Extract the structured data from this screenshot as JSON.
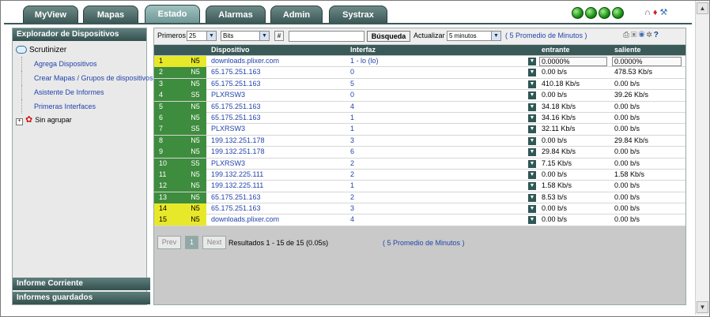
{
  "tabs": [
    {
      "label": "MyView",
      "active": false
    },
    {
      "label": "Mapas",
      "active": false
    },
    {
      "label": "Estado",
      "active": true
    },
    {
      "label": "Alarmas",
      "active": false
    },
    {
      "label": "Admin",
      "active": false
    },
    {
      "label": "Systrax",
      "active": false
    }
  ],
  "sidebar": {
    "title": "Explorador de Dispositivos",
    "root": "Scrutinizer",
    "links": [
      "Agrega Dispositivos",
      "Crear Mapas / Grupos de dispositivos",
      "Asistente De Informes",
      "Primeras Interfaces"
    ],
    "group": "Sin agrupar",
    "footer1": "Informe Corriente",
    "footer2": "Informes guardados"
  },
  "controls": {
    "primeros_label": "Primeros",
    "primeros_value": "25",
    "units_value": "Bits",
    "hash_label": "#",
    "search_value": "",
    "search_button": "Búsqueda",
    "actualizar_label": "Actualizar",
    "actualizar_value": "5 minutos",
    "avg_link": "( 5 Promedio de Minutos )"
  },
  "table": {
    "headers": {
      "device": "Dispositivo",
      "interface": "Interfaz",
      "in": "entrante",
      "out": "saliente"
    },
    "rows": [
      {
        "rank": "1",
        "kind": "N5",
        "device": "downloads.plixer.com",
        "interface": "1 - lo (lo)",
        "in": "0.0000%",
        "out": "0.0000%",
        "color": "yellow",
        "pct": true
      },
      {
        "rank": "2",
        "kind": "N5",
        "device": "65.175.251.163",
        "interface": "0",
        "in": "0.00 b/s",
        "out": "478.53 Kb/s",
        "color": "green"
      },
      {
        "rank": "3",
        "kind": "N5",
        "device": "65.175.251.163",
        "interface": "5",
        "in": "410.18 Kb/s",
        "out": "0.00 b/s",
        "color": "green"
      },
      {
        "rank": "4",
        "kind": "S5",
        "device": "PLXRSW3",
        "interface": "0",
        "in": "0.00 b/s",
        "out": "39.26 Kb/s",
        "color": "green"
      },
      {
        "rank": "5",
        "kind": "N5",
        "device": "65.175.251.163",
        "interface": "4",
        "in": "34.18 Kb/s",
        "out": "0.00 b/s",
        "color": "green"
      },
      {
        "rank": "6",
        "kind": "N5",
        "device": "65.175.251.163",
        "interface": "1",
        "in": "34.16 Kb/s",
        "out": "0.00 b/s",
        "color": "green"
      },
      {
        "rank": "7",
        "kind": "S5",
        "device": "PLXRSW3",
        "interface": "1",
        "in": "32.11 Kb/s",
        "out": "0.00 b/s",
        "color": "green"
      },
      {
        "rank": "8",
        "kind": "N5",
        "device": "199.132.251.178",
        "interface": "3",
        "in": "0.00 b/s",
        "out": "29.84 Kb/s",
        "color": "green"
      },
      {
        "rank": "9",
        "kind": "N5",
        "device": "199.132.251.178",
        "interface": "6",
        "in": "29.84 Kb/s",
        "out": "0.00 b/s",
        "color": "green"
      },
      {
        "rank": "10",
        "kind": "S5",
        "device": "PLXRSW3",
        "interface": "2",
        "in": "7.15 Kb/s",
        "out": "0.00 b/s",
        "color": "green"
      },
      {
        "rank": "11",
        "kind": "N5",
        "device": "199.132.225.111",
        "interface": "2",
        "in": "0.00 b/s",
        "out": "1.58 Kb/s",
        "color": "green"
      },
      {
        "rank": "12",
        "kind": "N5",
        "device": "199.132.225.111",
        "interface": "1",
        "in": "1.58 Kb/s",
        "out": "0.00 b/s",
        "color": "green"
      },
      {
        "rank": "13",
        "kind": "N5",
        "device": "65.175.251.163",
        "interface": "2",
        "in": "8.53 b/s",
        "out": "0.00 b/s",
        "color": "green"
      },
      {
        "rank": "14",
        "kind": "N5",
        "device": "65.175.251.163",
        "interface": "3",
        "in": "0.00 b/s",
        "out": "0.00 b/s",
        "color": "yellow"
      },
      {
        "rank": "15",
        "kind": "N5",
        "device": "downloads.plixer.com",
        "interface": "4",
        "in": "0.00 b/s",
        "out": "0.00 b/s",
        "color": "yellow"
      }
    ]
  },
  "pager": {
    "prev": "Prev",
    "page": "1",
    "next": "Next",
    "results": "Resultados 1 - 15 de 15 (0.05s)",
    "avg_link": "( 5 Promedio de Minutos )"
  },
  "colors": {
    "accent": "#3a5a59",
    "ok": "#3e8c3e",
    "warn": "#e8e82a",
    "link": "#2244aa"
  }
}
